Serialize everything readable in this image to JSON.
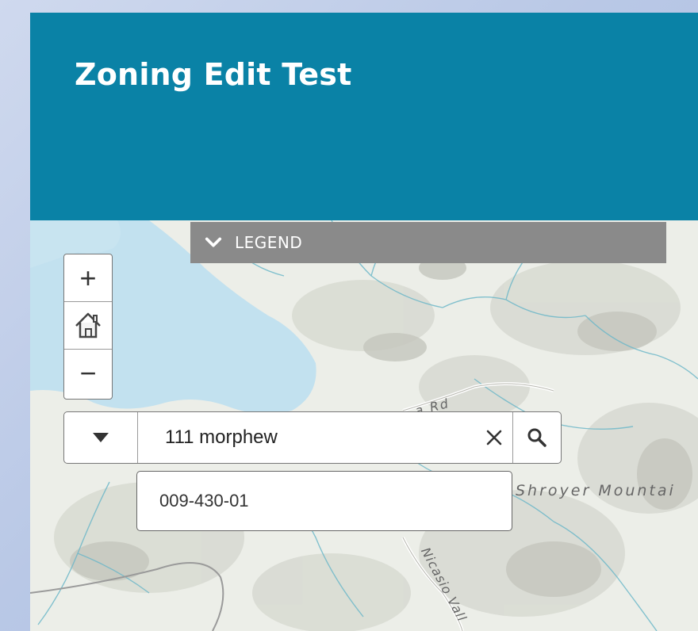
{
  "header": {
    "title": "Zoning Edit Test",
    "background": "#0a82a6"
  },
  "legend": {
    "label": "LEGEND",
    "icon": "chevron-down-icon"
  },
  "zoom_controls": {
    "zoom_in_label": "+",
    "home_icon": "home-icon",
    "zoom_out_label": "−"
  },
  "search": {
    "value": "111 morphew",
    "dropdown_icon": "caret-down-icon",
    "clear_icon": "close-icon",
    "search_icon": "search-icon"
  },
  "suggestions": [
    {
      "label": "009-430-01"
    }
  ],
  "map_labels": {
    "mountain": "Shroyer Mountai",
    "road_a": "a Rd",
    "road_b": "Nicasio Vall"
  },
  "colors": {
    "water": "#bfe0ef",
    "terrain": "#eef0ea",
    "stream": "#6fb8c9"
  }
}
